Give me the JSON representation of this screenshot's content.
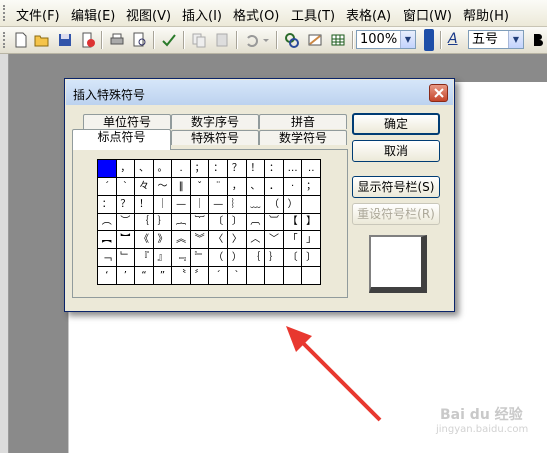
{
  "menubar": {
    "items": [
      "文件(F)",
      "编辑(E)",
      "视图(V)",
      "插入(I)",
      "格式(O)",
      "工具(T)",
      "表格(A)",
      "窗口(W)",
      "帮助(H)"
    ]
  },
  "toolbar": {
    "zoom": "100%",
    "font_size": "五号",
    "font_icon_label": "A"
  },
  "dialog": {
    "title": "插入特殊符号",
    "tabs_back": [
      "单位符号",
      "数字序号",
      "拼音"
    ],
    "tabs_front": [
      "标点符号",
      "特殊符号",
      "数学符号"
    ],
    "buttons": {
      "ok": "确定",
      "cancel": "取消",
      "show_bar": "显示符号栏(S)",
      "reset_bar": "重设符号栏(R)"
    },
    "symbols": [
      [
        "",
        "，",
        "、",
        "。",
        ".",
        "；",
        "：",
        "？",
        "！",
        "：",
        "…",
        "‥"
      ],
      [
        "ˊ",
        "ˋ",
        "々",
        "～",
        "‖",
        "ˇ",
        "¨",
        "，",
        "、",
        "．",
        "·",
        "；"
      ],
      [
        "：",
        "？",
        "！",
        "｜",
        "—",
        "｜",
        "—",
        "︴",
        "﹏",
        "（",
        "）",
        ""
      ],
      [
        "︵",
        "︶",
        "｛",
        "｝",
        "︷",
        "︸",
        "〔",
        "〕",
        "︹",
        "︺",
        "【",
        "】"
      ],
      [
        "︻",
        "︼",
        "《",
        "》",
        "︽",
        "︾",
        "〈",
        "〉",
        "︿",
        "﹀",
        "「",
        "」"
      ],
      [
        "﹁",
        "﹂",
        "『",
        "』",
        "﹃",
        "﹄",
        "（",
        "）",
        "｛",
        "｝",
        "〔",
        "〕"
      ],
      [
        "‘",
        "’",
        "“",
        "”",
        "〝",
        "〞",
        "ˊ",
        "ˋ",
        "",
        "",
        "",
        ""
      ]
    ]
  },
  "watermark": {
    "brand": "Bai du 经验",
    "url": "jingyan.baidu.com"
  },
  "colors": {
    "selected_cell": "#0000ff",
    "arrow": "#e8382f"
  }
}
